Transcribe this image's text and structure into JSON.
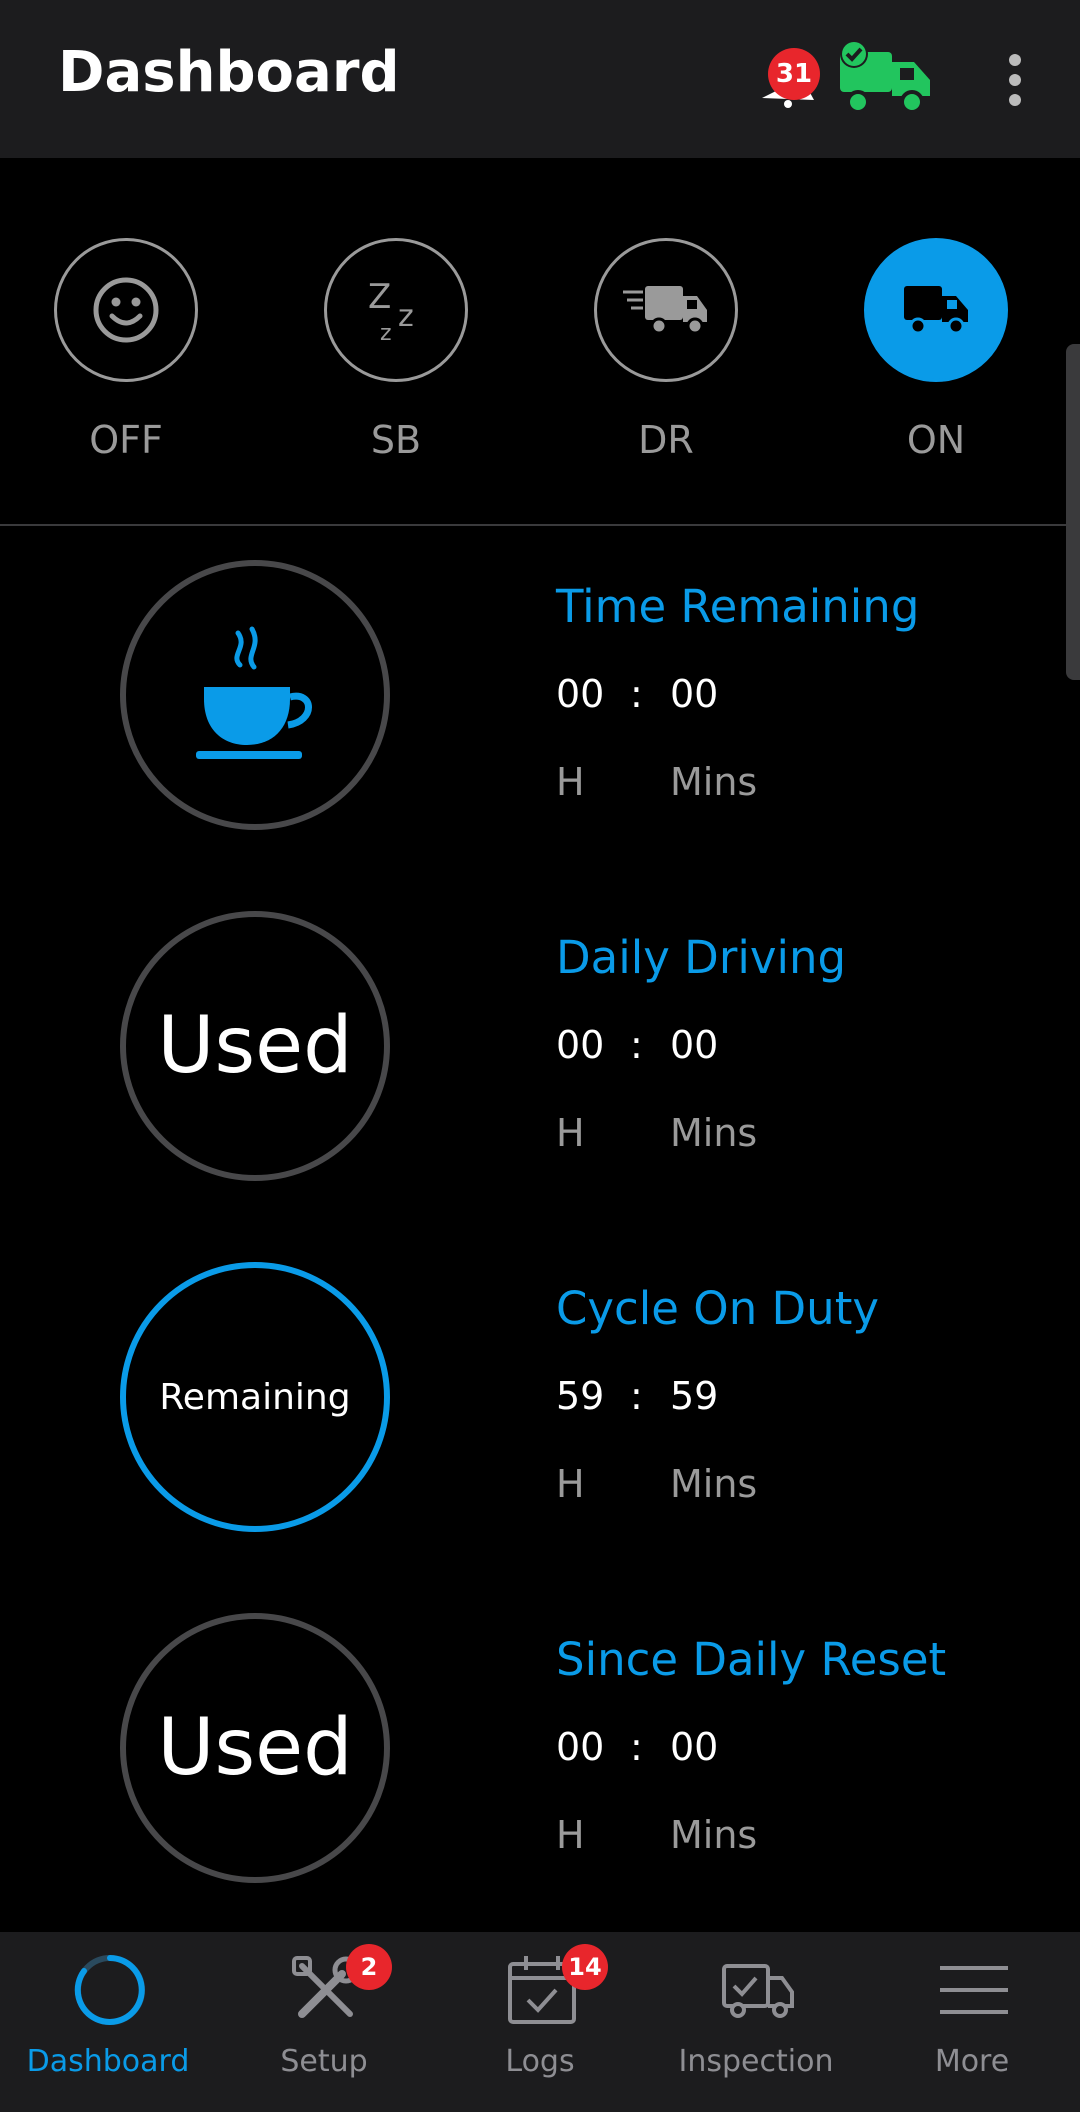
{
  "header": {
    "title": "Dashboard",
    "notification_count": "31",
    "truck_status_icon": "truck-connected-icon",
    "more_icon": "overflow-menu-icon"
  },
  "statuses": [
    {
      "label": "OFF",
      "icon": "smiley-icon",
      "active": false
    },
    {
      "label": "SB",
      "icon": "sleep-icon",
      "active": false
    },
    {
      "label": "DR",
      "icon": "driving-truck-icon",
      "active": false
    },
    {
      "label": "ON",
      "icon": "truck-icon",
      "active": true
    }
  ],
  "timers": [
    {
      "title": "Time Remaining",
      "ring_text": "",
      "ring_icon": "coffee-cup-icon",
      "hours": "00",
      "sep": ":",
      "mins": "00",
      "h_unit": "H",
      "m_unit": "Mins"
    },
    {
      "title": "Daily Driving",
      "ring_text": "Used",
      "hours": "00",
      "sep": ":",
      "mins": "00",
      "h_unit": "H",
      "m_unit": "Mins"
    },
    {
      "title": "Cycle On Duty",
      "ring_text": "Remaining",
      "hours": "59",
      "sep": ":",
      "mins": "59",
      "h_unit": "H",
      "m_unit": "Mins"
    },
    {
      "title": "Since Daily Reset",
      "ring_text": "Used",
      "hours": "00",
      "sep": ":",
      "mins": "00",
      "h_unit": "H",
      "m_unit": "Mins"
    }
  ],
  "bottom_nav": [
    {
      "label": "Dashboard",
      "active": true,
      "badge": ""
    },
    {
      "label": "Setup",
      "active": false,
      "badge": "2"
    },
    {
      "label": "Logs",
      "active": false,
      "badge": "14"
    },
    {
      "label": "Inspection",
      "active": false,
      "badge": ""
    },
    {
      "label": "More",
      "active": false,
      "badge": ""
    }
  ],
  "colors": {
    "accent": "#0a9be8",
    "badge": "#e8262c",
    "connected": "#22c55e"
  }
}
